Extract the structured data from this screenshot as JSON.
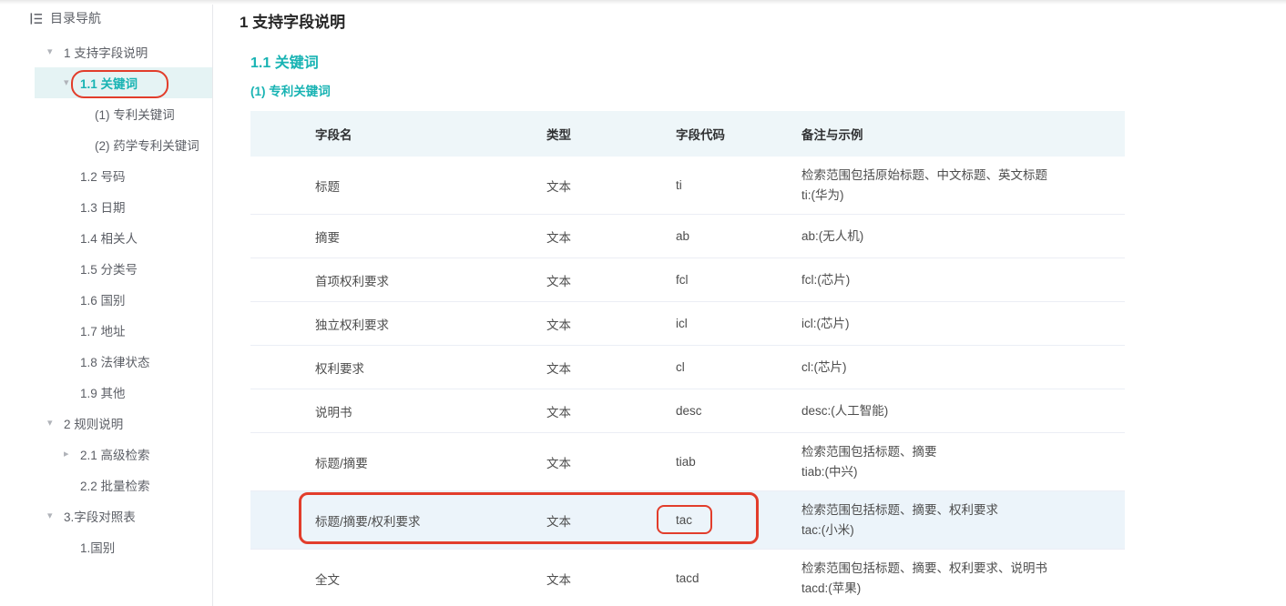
{
  "colors": {
    "accent_teal": "#18b3b3",
    "annotation_red": "#e23d2b",
    "selected_item_bg": "#e5f3f4",
    "table_header_bg": "#eef6f9",
    "highlight_row_bg": "#ecf4fa",
    "row_border": "#ebeef5",
    "sidebar_border": "#e6e8eb",
    "text_dark": "#262626",
    "text_body": "#4d4d4d",
    "text_sidebar": "#5c5f66",
    "chevron_gray": "#b0b3b9"
  },
  "sidebar": {
    "header": {
      "label": "目录导航",
      "icon": "toc-outline-icon"
    },
    "items": [
      {
        "label": "1 支持字段说明",
        "level": 1,
        "chevron": "down",
        "selected": false
      },
      {
        "label": "1.1 关键词",
        "level": 2,
        "chevron": "down",
        "selected": true
      },
      {
        "label": "(1) 专利关键词",
        "level": 3,
        "chevron": null,
        "selected": false
      },
      {
        "label": "(2) 药学专利关键词",
        "level": 3,
        "chevron": null,
        "selected": false
      },
      {
        "label": "1.2 号码",
        "level": 2,
        "chevron": null,
        "selected": false
      },
      {
        "label": "1.3 日期",
        "level": 2,
        "chevron": null,
        "selected": false
      },
      {
        "label": "1.4 相关人",
        "level": 2,
        "chevron": null,
        "selected": false
      },
      {
        "label": "1.5 分类号",
        "level": 2,
        "chevron": null,
        "selected": false
      },
      {
        "label": "1.6 国别",
        "level": 2,
        "chevron": null,
        "selected": false
      },
      {
        "label": "1.7 地址",
        "level": 2,
        "chevron": null,
        "selected": false
      },
      {
        "label": "1.8 法律状态",
        "level": 2,
        "chevron": null,
        "selected": false
      },
      {
        "label": "1.9 其他",
        "level": 2,
        "chevron": null,
        "selected": false
      },
      {
        "label": "2 规则说明",
        "level": 1,
        "chevron": "down",
        "selected": false
      },
      {
        "label": "2.1 高级检索",
        "level": 2,
        "chevron": "right",
        "selected": false
      },
      {
        "label": "2.2 批量检索",
        "level": 2,
        "chevron": null,
        "selected": false
      },
      {
        "label": "3.字段对照表",
        "level": 1,
        "chevron": "down",
        "selected": false
      },
      {
        "label": "1.国别",
        "level": 2,
        "chevron": null,
        "selected": false
      }
    ]
  },
  "main": {
    "page_title": "1 支持字段说明",
    "section_title": "1.1 关键词",
    "subsection_title": "(1) 专利关键词",
    "table": {
      "headers": [
        "字段名",
        "类型",
        "字段代码",
        "备注与示例"
      ],
      "rows": [
        {
          "field": "标题",
          "type": "文本",
          "code": "ti",
          "remark": [
            "检索范围包括原始标题、中文标题、英文标题",
            "ti:(华为)"
          ],
          "highlighted": false,
          "code_annotated": false
        },
        {
          "field": "摘要",
          "type": "文本",
          "code": "ab",
          "remark": [
            "ab:(无人机)"
          ],
          "highlighted": false,
          "code_annotated": false
        },
        {
          "field": "首项权利要求",
          "type": "文本",
          "code": "fcl",
          "remark": [
            "fcl:(芯片)"
          ],
          "highlighted": false,
          "code_annotated": false
        },
        {
          "field": "独立权利要求",
          "type": "文本",
          "code": "icl",
          "remark": [
            "icl:(芯片)"
          ],
          "highlighted": false,
          "code_annotated": false
        },
        {
          "field": "权利要求",
          "type": "文本",
          "code": "cl",
          "remark": [
            "cl:(芯片)"
          ],
          "highlighted": false,
          "code_annotated": false
        },
        {
          "field": "说明书",
          "type": "文本",
          "code": "desc",
          "remark": [
            "desc:(人工智能)"
          ],
          "highlighted": false,
          "code_annotated": false
        },
        {
          "field": "标题/摘要",
          "type": "文本",
          "code": "tiab",
          "remark": [
            "检索范围包括标题、摘要",
            "tiab:(中兴)"
          ],
          "highlighted": false,
          "code_annotated": false
        },
        {
          "field": "标题/摘要/权利要求",
          "type": "文本",
          "code": "tac",
          "remark": [
            "检索范围包括标题、摘要、权利要求",
            "tac:(小米)"
          ],
          "highlighted": true,
          "code_annotated": true
        },
        {
          "field": "全文",
          "type": "文本",
          "code": "tacd",
          "remark": [
            "检索范围包括标题、摘要、权利要求、说明书",
            "tacd:(苹果)"
          ],
          "highlighted": false,
          "code_annotated": false
        }
      ]
    }
  },
  "annotations": {
    "sidebar_box_target": "1.1 关键词",
    "row_box_target": "标题/摘要/权利要求 row",
    "code_box_target": "tac"
  }
}
